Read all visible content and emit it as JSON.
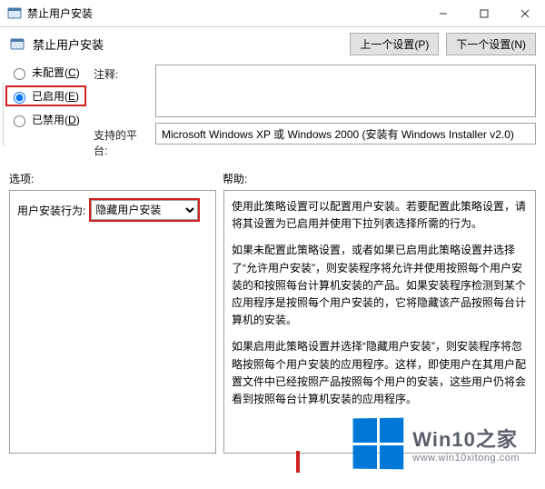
{
  "window": {
    "title": "禁止用户安装"
  },
  "header": {
    "title": "禁止用户安装",
    "prev_btn": "上一个设置(P)",
    "next_btn": "下一个设置(N)"
  },
  "radios": {
    "not_configured": {
      "label": "未配置",
      "hotkey": "C",
      "checked": false
    },
    "enabled": {
      "label": "已启用",
      "hotkey": "E",
      "checked": true
    },
    "disabled": {
      "label": "已禁用",
      "hotkey": "D",
      "checked": false
    }
  },
  "labels": {
    "comment": "注释:",
    "platform": "支持的平台:",
    "options": "选项:",
    "help": "帮助:"
  },
  "fields": {
    "comment_value": "",
    "platform_value": "Microsoft Windows XP 或 Windows 2000 (安装有 Windows Installer v2.0)"
  },
  "options": {
    "behavior_label": "用户安装行为:",
    "behavior_value": "隐藏用户安装"
  },
  "help": {
    "p1": "使用此策略设置可以配置用户安装。若要配置此策略设置，请将其设置为已启用并使用下拉列表选择所需的行为。",
    "p2": "如果未配置此策略设置，或者如果已启用此策略设置并选择了“允许用户安装”，则安装程序将允许并使用按照每个用户安装的和按照每台计算机安装的产品。如果安装程序检测到某个应用程序是按照每个用户安装的，它将隐藏该产品按照每台计算机的安装。",
    "p3": "如果启用此策略设置并选择“隐藏用户安装”，则安装程序将忽略按照每个用户安装的应用程序。这样，即使用户在其用户配置文件中已经按照产品按照每个用户的安装，这些用户仍将会看到按照每台计算机安装的应用程序。"
  },
  "watermark": {
    "brand": "Win10之家",
    "url": "www.win10xitong.com"
  }
}
